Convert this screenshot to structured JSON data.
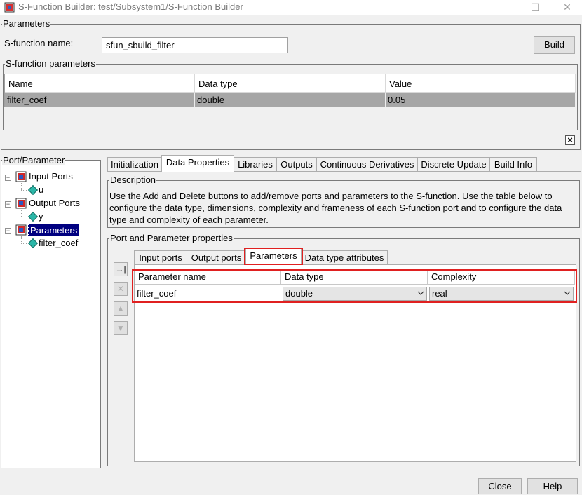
{
  "window": {
    "title": "S-Function Builder: test/Subsystem1/S-Function Builder",
    "minimize_icon": "minimize-icon",
    "maximize_icon": "maximize-icon",
    "close_icon": "close-icon"
  },
  "parameters_group": {
    "label": "Parameters",
    "sfun_name_label": "S-function name:",
    "sfun_name_value": "sfun_sbuild_filter",
    "build_label": "Build"
  },
  "sfun_params_group": {
    "label": "S-function parameters",
    "columns": [
      "Name",
      "Data type",
      "Value"
    ],
    "rows": [
      {
        "name": "filter_coef",
        "type": "double",
        "value": "0.05"
      }
    ],
    "close_label": "×"
  },
  "port_tree": {
    "label": "Port/Parameter",
    "input_ports": "Input Ports",
    "input_child": "u",
    "output_ports": "Output Ports",
    "output_child": "y",
    "parameters": "Parameters",
    "parameters_child": "filter_coef"
  },
  "tabs": [
    "Initialization",
    "Data Properties",
    "Libraries",
    "Outputs",
    "Continuous Derivatives",
    "Discrete Update",
    "Build Info"
  ],
  "description": {
    "label": "Description",
    "line1": "Use the Add and Delete buttons to add/remove ports and parameters to the S-function. Use the table below to",
    "line2": "configure the data type, dimensions, complexity and frameness of each S-function port and to configure the data",
    "line3": "type and complexity of each parameter."
  },
  "pp_group": {
    "label": "Port and Parameter properties",
    "subtabs": [
      "Input ports",
      "Output ports",
      "Parameters",
      "Data type attributes"
    ],
    "columns": [
      "Parameter name",
      "Data type",
      "Complexity"
    ],
    "rows": [
      {
        "name": "filter_coef",
        "type": "double",
        "complexity": "real"
      }
    ]
  },
  "footer": {
    "close_label": "Close",
    "help_label": "Help"
  },
  "colors": {
    "highlight": "#e02020",
    "selected_row": "#a6a6a6",
    "selected_tree": "#000080"
  }
}
